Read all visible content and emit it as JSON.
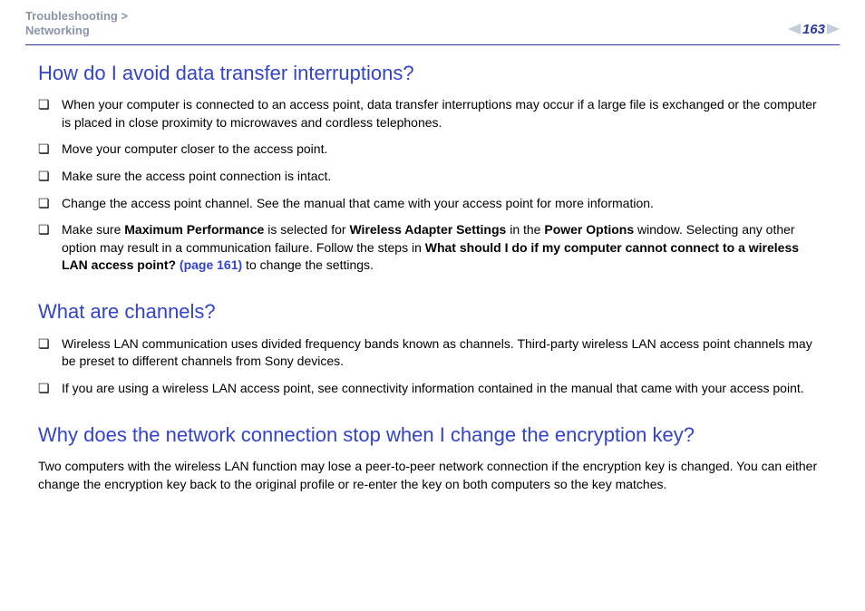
{
  "breadcrumb": {
    "line1": "Troubleshooting >",
    "line2": "Networking"
  },
  "page_number": "163",
  "section1": {
    "title": "How do I avoid data transfer interruptions?",
    "items": {
      "b1": "When your computer is connected to an access point, data transfer interruptions may occur if a large file is exchanged or the computer is placed in close proximity to microwaves and cordless telephones.",
      "b2": "Move your computer closer to the access point.",
      "b3": "Make sure the access point connection is intact.",
      "b4": "Change the access point channel. See the manual that came with your access point for more information.",
      "b5_pre": "Make sure ",
      "b5_bold1": "Maximum Performance",
      "b5_mid1": " is selected for ",
      "b5_bold2": "Wireless Adapter Settings",
      "b5_mid2": " in the ",
      "b5_bold3": "Power Options",
      "b5_mid3": " window. Selecting any other option may result in a communication failure. Follow the steps in ",
      "b5_bold4": "What should I do if my computer cannot connect to a wireless LAN access point?",
      "b5_link": " (page 161)",
      "b5_post": " to change the settings."
    }
  },
  "section2": {
    "title": "What are channels?",
    "items": {
      "c1": "Wireless LAN communication uses divided frequency bands known as channels. Third-party wireless LAN access point channels may be preset to different channels from Sony devices.",
      "c2": "If you are using a wireless LAN access point, see connectivity information contained in the manual that came with your access point."
    }
  },
  "section3": {
    "title": "Why does the network connection stop when I change the encryption key?",
    "body": "Two computers with the wireless LAN function may lose a peer-to-peer network connection if the encryption key is changed. You can either change the encryption key back to the original profile or re-enter the key on both computers so the key matches."
  }
}
